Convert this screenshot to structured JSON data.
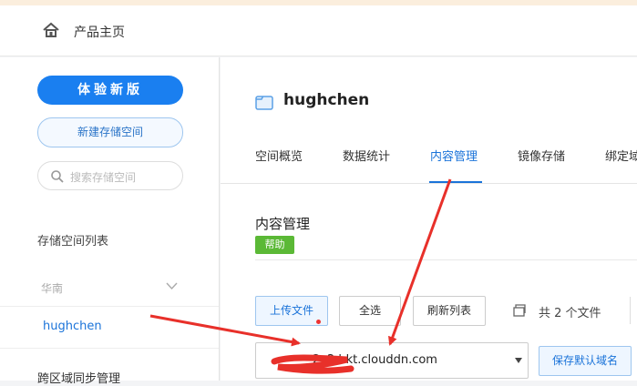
{
  "header": {
    "home_icon": "home-icon",
    "home_label": "产品主页"
  },
  "sidebar": {
    "new_version_button": "体验新版",
    "create_bucket_button": "新建存储空间",
    "search_placeholder": "搜索存储空间",
    "bucket_list_title": "存储空间列表",
    "region_label": "华南",
    "buckets": [
      "hughchen"
    ],
    "cross_region_sync": "跨区域同步管理"
  },
  "main": {
    "bucket_name": "hughchen",
    "tabs": [
      {
        "label": "空间概览",
        "active": false
      },
      {
        "label": "数据统计",
        "active": false
      },
      {
        "label": "内容管理",
        "active": true
      },
      {
        "label": "镜像存储",
        "active": false
      },
      {
        "label": "绑定域",
        "active": false
      }
    ],
    "section_title": "内容管理",
    "help_badge": "帮助",
    "toolbar": {
      "upload": "上传文件",
      "select_all": "全选",
      "refresh": "刷新列表",
      "file_count": "共 2 个文件"
    },
    "domain_select_value": "2v2.bkt.clouddn.com",
    "save_default_domain": "保存默认域名"
  },
  "colors": {
    "accent": "#1a7ff0",
    "link": "#1a73d9",
    "help_green": "#5bb936",
    "annotation_red": "#e8302a"
  }
}
